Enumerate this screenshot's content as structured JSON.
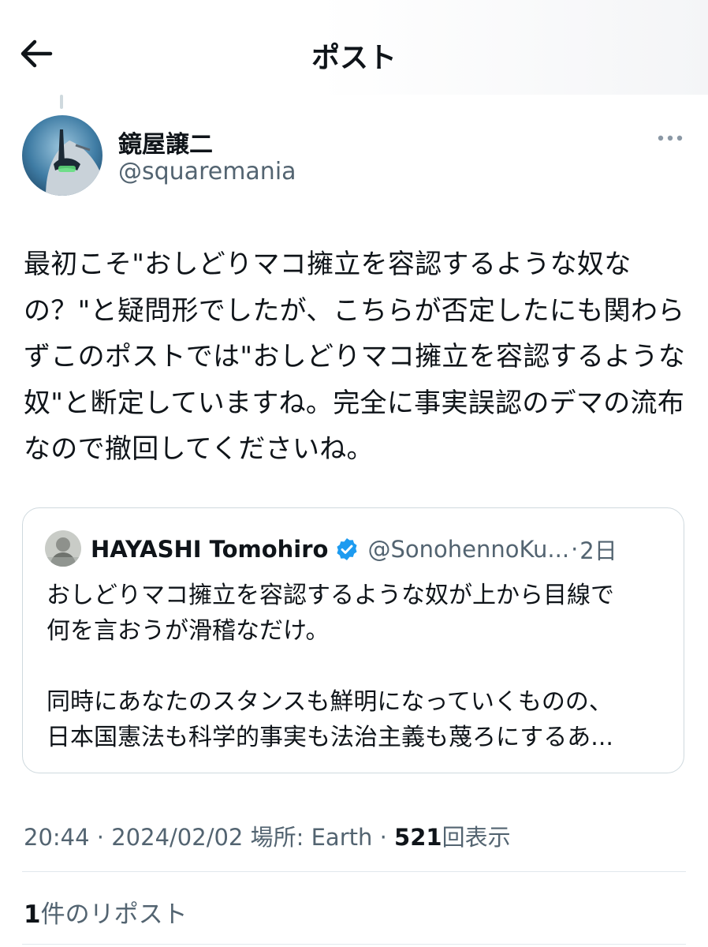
{
  "header": {
    "title": "ポスト",
    "back_icon": "arrow-left-icon"
  },
  "author": {
    "name": "鏡屋譲二",
    "handle": "@squaremania",
    "more_icon": "more-horizontal-icon"
  },
  "post": {
    "text": "最初こそ\"おしどりマコ擁立を容認するような奴なの？\"と疑問形でしたが、こちらが否定したにも関わらずこのポストでは\"おしどりマコ擁立を容認するような奴\"と断定していますね。完全に事実誤認のデマの流布なので撤回してくださいね。"
  },
  "quote": {
    "name": "HAYASHI Tomohiro",
    "verified_icon": "verified-badge-icon",
    "handle": "@SonohennoKu...",
    "separator": "·",
    "time": "2日",
    "text": "おしどりマコ擁立を容認するような奴が上から目線で\n何を言おうが滑稽なだけ。\n\n同時にあなたのスタンスも鮮明になっていくものの、\n日本国憲法も科学的事実も法治主義も蔑ろにするあ..."
  },
  "meta": {
    "time": "20:44",
    "date": "2024/02/02",
    "location_label": "場所: Earth",
    "separator": "·",
    "views_count": "521",
    "views_label": "回表示"
  },
  "reposts": {
    "count": "1",
    "label": "件のリポスト"
  },
  "colors": {
    "text": "#0f1419",
    "secondary": "#536471",
    "border": "#cfd9de",
    "verified": "#1d9bf0"
  }
}
